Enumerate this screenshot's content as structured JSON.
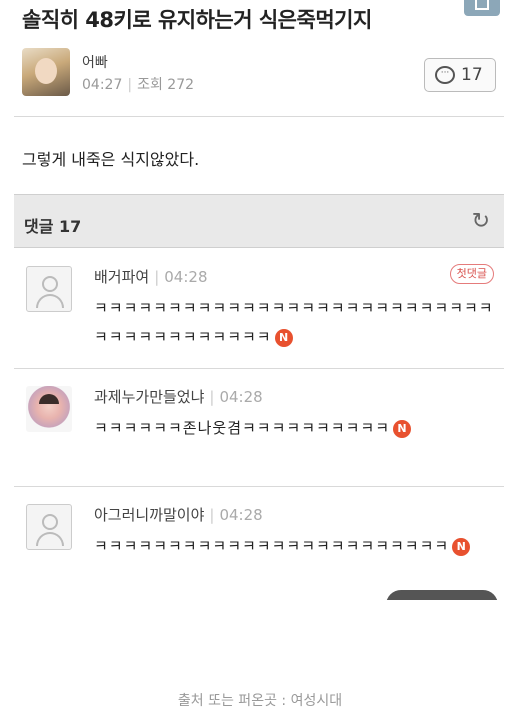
{
  "post": {
    "title": "솔직히 48키로 유지하는거 식은죽먹기지",
    "author": "어빠",
    "time": "04:27",
    "views_label": "조회 272",
    "comment_count": "17",
    "body": "그렇게 내죽은 식지않았다."
  },
  "comments_header": {
    "label": "댓글 17",
    "refresh_icon": "refresh-icon"
  },
  "comments": [
    {
      "user": "배거파여",
      "time": "04:28",
      "badge": "첫댓글",
      "text": "ㅋㅋㅋㅋㅋㅋㅋㅋㅋㅋㅋㅋㅋㅋㅋㅋㅋㅋㅋㅋㅋㅋㅋㅋㅋㅋㅋㅋㅋㅋㅋㅋㅋㅋㅋㅋㅋㅋㅋ",
      "new_badge": "N"
    },
    {
      "user": "과제누가만들었냐",
      "time": "04:28",
      "text": "ㅋㅋㅋㅋㅋㅋ존나웃겸ㅋㅋㅋㅋㅋㅋㅋㅋㅋㅋ",
      "new_badge": "N"
    },
    {
      "user": "아그러니까말이야",
      "time": "04:28",
      "text": "ㅋㅋㅋㅋㅋㅋㅋㅋㅋㅋㅋㅋㅋㅋㅋㅋㅋㅋㅋㅋㅋㅋㅋㅋ",
      "new_badge": "N"
    }
  ],
  "caption": "출처 또는 퍼온곳 : 여성시대",
  "colors": {
    "new_badge": "#e8512f",
    "first_badge": "#d9534f",
    "header_bg": "#e9e9e9"
  }
}
